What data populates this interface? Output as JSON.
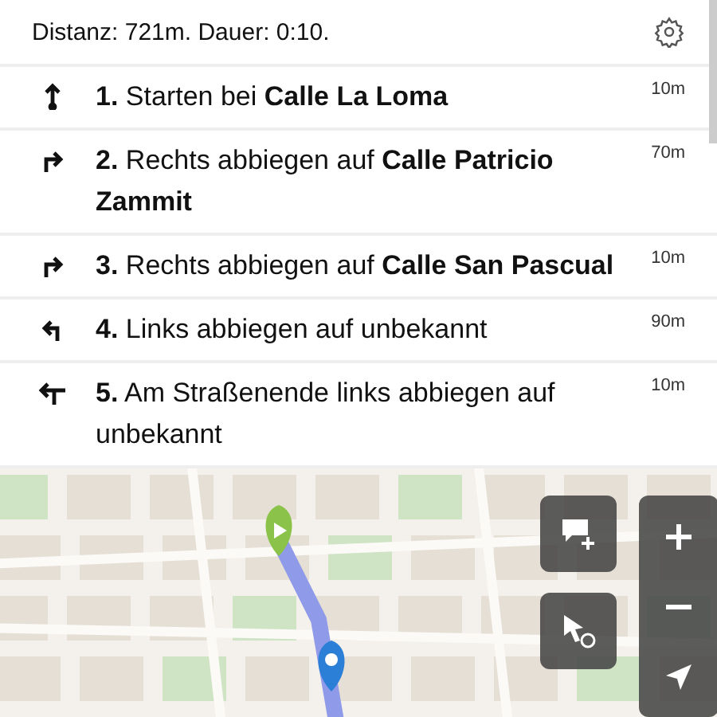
{
  "summary": "Distanz: 721m. Dauer: 0:10.",
  "steps": [
    {
      "kind": "straight",
      "number": "1.",
      "text": "Starten bei **Calle La Loma**",
      "distance": "10m"
    },
    {
      "kind": "right",
      "number": "2.",
      "text": "Rechts abbiegen auf **Calle Patricio Zammit**",
      "distance": "70m"
    },
    {
      "kind": "right",
      "number": "3.",
      "text": "Rechts abbiegen auf **Calle San Pascual**",
      "distance": "10m"
    },
    {
      "kind": "left",
      "number": "4.",
      "text": "Links abbiegen auf unbekannt",
      "distance": "90m"
    },
    {
      "kind": "end-left",
      "number": "5.",
      "text": "Am Straßenende links abbiegen auf unbekannt",
      "distance": "10m"
    }
  ]
}
